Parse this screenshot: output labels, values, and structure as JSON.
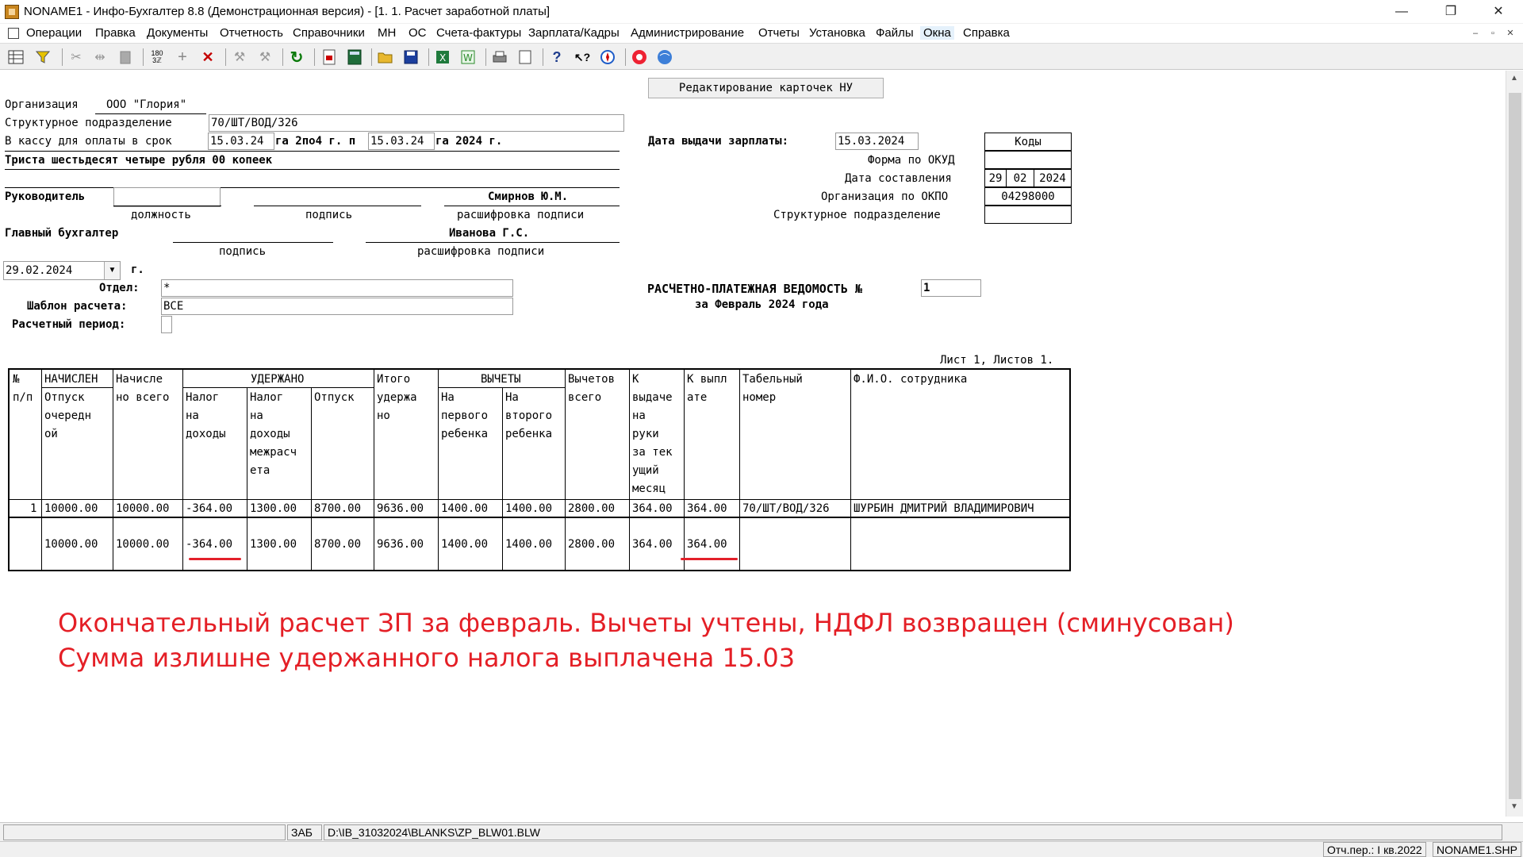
{
  "window": {
    "title": "NONAME1 - Инфо-Бухгалтер 8.8 (Демонстрационная версия) - [1. 1. Расчет заработной платы]",
    "minimize": "—",
    "restore": "❐",
    "close": "✕"
  },
  "menu": [
    "Операции",
    "Правка",
    "Документы",
    "Отчетность",
    "Справочники",
    "МН",
    "ОС",
    "Счета-фактуры",
    "Зарплата/Кадры",
    "Администрирование",
    "Отчеты",
    "Установка",
    "Файлы",
    "Окна",
    "Справка"
  ],
  "toolbar_icons": [
    "table-icon",
    "filter-icon",
    "cut-icon",
    "split-icon",
    "paste-icon",
    "numbers-icon",
    "add-icon",
    "delete-icon",
    "tool-icon",
    "tool2-icon",
    "refresh-icon",
    "report-icon",
    "calculator-icon",
    "open-folder-icon",
    "save-icon",
    "excel-icon",
    "word-icon",
    "print-icon",
    "preview-icon",
    "help-icon",
    "context-help-icon",
    "compass-icon",
    "lifebuoy-icon",
    "globe-icon"
  ],
  "header": {
    "edit_button": "Редактирование карточек НУ",
    "org_label": "Организация",
    "org_value": "ООО \"Глория\"",
    "struct_label": "Структурное подразделение",
    "struct_value": "70/ШТ/ВОД/326",
    "cash_label": "В кассу для оплаты в срок",
    "cash_from": "15.03.24",
    "cash_mid": "га 2по4 г. п",
    "cash_to": "15.03.24",
    "cash_end": "га 2024 г.",
    "amount_words": "Триста шестьдесят четыре рубля 00 копеек",
    "head_label": "Руководитель",
    "head_name": "Смирнов Ю.М.",
    "position_caption": "должность",
    "signature_caption": "подпись",
    "decode_caption": "расшифровка подписи",
    "chief_label": "Главный бухгалтер",
    "chief_name": "Иванова Г.С.",
    "signature_caption2": "подпись",
    "decode_caption2": "расшифровка подписи",
    "date_value": "29.02.2024",
    "date_suffix": "г.",
    "dept_label": "Отдел:",
    "dept_value": "*",
    "template_label": "Шаблон расчета:",
    "template_value": "ВСЕ",
    "period_label": "Расчетный период:",
    "pay_date_label": "Дата выдачи зарплаты:",
    "pay_date_value": "15.03.2024"
  },
  "codes": {
    "header": "Коды",
    "okud_label": "Форма по ОКУД",
    "okud_value": "",
    "date_label": "Дата составления",
    "day": "29",
    "month": "02",
    "year": "2024",
    "okpo_label": "Организация по ОКПО",
    "okpo_value": "04298000",
    "subdiv_label": "Структурное подразделение",
    "subdiv_value": ""
  },
  "statement": {
    "title": "РАСЧЕТНО-ПЛАТЕЖНАЯ ВЕДОМОСТЬ №",
    "number": "1",
    "subtitle": "за Февраль 2024 года",
    "sheet_info": "Лист 1, Листов 1."
  },
  "table": {
    "col_num": [
      "№",
      "п/п"
    ],
    "accrued_group": "НАЧИСЛЕН",
    "col_vacation": [
      "Отпуск",
      "очередн",
      "ой"
    ],
    "col_accrued_total": [
      "Начисле",
      "но всего"
    ],
    "withheld_group": "УДЕРЖАНО",
    "col_income_tax": [
      "Налог",
      "на",
      "доходы"
    ],
    "col_income_tax_interval": [
      "Налог",
      "на",
      "доходы",
      "межрасч",
      "ета"
    ],
    "col_vacation_w": [
      "Отпуск"
    ],
    "col_withheld_total": [
      "Итого",
      "удержа",
      "но"
    ],
    "deductions_group": "ВЫЧЕТЫ",
    "col_first_child": [
      "На",
      "первого",
      "ребенка"
    ],
    "col_second_child": [
      "На",
      "второго",
      "ребенка"
    ],
    "col_deductions_total": [
      "Вычетов",
      "всего"
    ],
    "col_to_pay": [
      "К",
      "выдаче",
      "на",
      "руки",
      "за тек",
      "ущий",
      "месяц"
    ],
    "col_payout": [
      "К выпл",
      "ате"
    ],
    "col_tab": [
      "Табельный",
      "номер"
    ],
    "col_fio": [
      "Ф.И.О. сотрудника"
    ],
    "row": {
      "n": "1",
      "vacation": "10000.00",
      "accrued_total": "10000.00",
      "income_tax": "-364.00",
      "income_tax_interval": "1300.00",
      "vacation_w": "8700.00",
      "withheld_total": "9636.00",
      "first_child": "1400.00",
      "second_child": "1400.00",
      "deductions_total": "2800.00",
      "to_pay": "364.00",
      "payout": "364.00",
      "tab": "70/ШТ/ВОД/326",
      "fio": "ШУРБИН ДМИТРИЙ ВЛАДИМИРОВИЧ"
    },
    "total": {
      "vacation": "10000.00",
      "accrued_total": "10000.00",
      "income_tax": "-364.00",
      "income_tax_interval": "1300.00",
      "vacation_w": "8700.00",
      "withheld_total": "9636.00",
      "first_child": "1400.00",
      "second_child": "1400.00",
      "deductions_total": "2800.00",
      "to_pay": "364.00",
      "payout": "364.00"
    }
  },
  "annotation": {
    "line1": "Окончательный расчет ЗП за февраль. Вычеты учтены, НДФЛ возвращен (сминусован)",
    "line2": "Сумма излишне удержанного налога выплачена 15.03",
    "color": "#e41f26"
  },
  "status": {
    "mode": "ЗАБ",
    "path": "D:\\IB_31032024\\BLANKS\\ZP_BLW01.BLW",
    "period": "Отч.пер.: I кв.2022",
    "file": "NONAME1.SHP"
  }
}
